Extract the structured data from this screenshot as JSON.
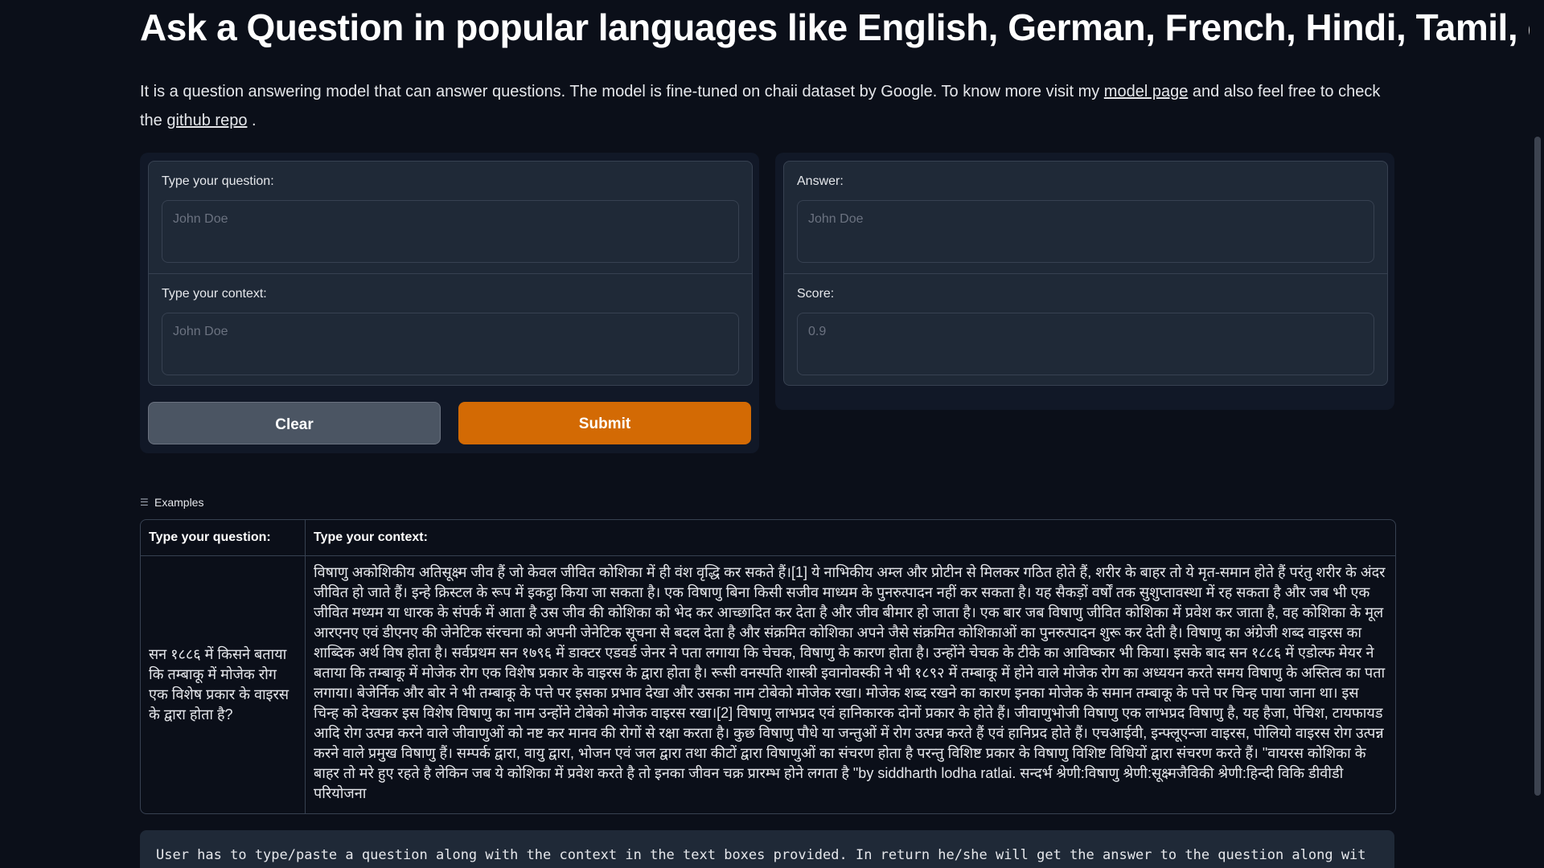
{
  "page": {
    "title": "Ask a Question in popular languages like English, German, French, Hindi, Tamil, etc",
    "description_pre": "It is a question answering model that can answer questions. The model is fine-tuned on chaii dataset by Google. To know more visit my ",
    "model_link": "model page",
    "description_mid": " and also feel free to check the ",
    "github_link": "github repo",
    "description_post": " ."
  },
  "inputs": {
    "question_label": "Type your question:",
    "question_placeholder": "John Doe",
    "context_label": "Type your context:",
    "context_placeholder": "John Doe"
  },
  "outputs": {
    "answer_label": "Answer:",
    "answer_placeholder": "John Doe",
    "score_label": "Score:",
    "score_placeholder": "0.9"
  },
  "buttons": {
    "clear": "Clear",
    "submit": "Submit"
  },
  "examples": {
    "header": "Examples",
    "col_question": "Type your question:",
    "col_context": "Type your context:",
    "rows": [
      {
        "question": "सन १८८६ में किसने बताया कि तम्बाकू में मोजेक रोग एक विशेष प्रकार के वाइरस के द्वारा होता है?",
        "context": "विषाणु अकोशिकीय अतिसूक्ष्म जीव हैं जो केवल जीवित कोशिका में ही वंश वृद्धि कर सकते हैं।[1] ये नाभिकीय अम्ल और प्रोटीन से मिलकर गठित होते हैं, शरीर के बाहर तो ये मृत-समान होते हैं परंतु शरीर के अंदर जीवित हो जाते हैं। इन्हे क्रिस्टल के रूप में इकट्ठा किया जा सकता है। एक विषाणु बिना किसी सजीव माध्यम के पुनरुत्पादन नहीं कर सकता है। यह सैकड़ों वर्षों तक सुशुप्तावस्था में रह सकता है और जब भी एक जीवित मध्यम या धारक के संपर्क में आता है उस जीव की कोशिका को भेद कर आच्छादित कर देता है और जीव बीमार हो जाता है। एक बार जब विषाणु जीवित कोशिका में प्रवेश कर जाता है, वह कोशिका के मूल आरएनए एवं डीएनए की जेनेटिक संरचना को अपनी जेनेटिक सूचना से बदल देता है और संक्रमित कोशिका अपने जैसे संक्रमित कोशिकाओं का पुनरुत्पादन शुरू कर देती है। विषाणु का अंग्रेजी शब्द वाइरस का शाब्दिक अर्थ विष होता है। सर्वप्रथम सन १७९६ में डाक्टर एडवर्ड जेनर ने पता लगाया कि चेचक, विषाणु के कारण होता है। उन्होंने चेचक के टीके का आविष्कार भी किया। इसके बाद सन १८८६ में एडोल्फ मेयर ने बताया कि तम्बाकू में मोजेक रोग एक विशेष प्रकार के वाइरस के द्वारा होता है। रूसी वनस्पति शास्त्री इवानोवस्की ने भी १८९२ में तम्बाकू में होने वाले मोजेक रोग का अध्ययन करते समय विषाणु के अस्तित्व का पता लगाया। बेजेर्निक और बोर ने भी तम्बाकू के पत्ते पर इसका प्रभाव देखा और उसका नाम टोबेको मोजेक रखा। मोजेक शब्द रखने का कारण इनका मोजेक के समान तम्बाकू के पत्ते पर चिन्ह पाया जाना था। इस चिन्ह को देखकर इस विशेष विषाणु का नाम उन्होंने टोबेको मोजेक वाइरस रखा।[2] विषाणु लाभप्रद एवं हानिकारक दोनों प्रकार के होते हैं। जीवाणुभोजी विषाणु एक लाभप्रद विषाणु है, यह हैजा, पेचिश, टायफायड आदि रोग उत्पन्न करने वाले जीवाणुओं को नष्ट कर मानव की रोगों से रक्षा करता है। कुछ विषाणु पौधे या जन्तुओं में रोग उत्पन्न करते हैं एवं हानिप्रद होते हैं। एचआईवी, इन्फ्लूएन्जा वाइरस, पोलियो वाइरस रोग उत्पन्न करने वाले प्रमुख विषाणु हैं। सम्पर्क द्वारा, वायु द्वारा, भोजन एवं जल द्वारा तथा कीटों द्वारा विषाणुओं का संचरण होता है परन्तु विशिष्ट प्रकार के विषाणु विशिष्ट विधियों द्वारा संचरण करते हैं। \"वायरस कोशिका के बाहर तो मरे हुए रहते है लेकिन जब ये कोशिका में प्रवेश करते है तो इनका जीवन चक्र प्रारम्भ होने लगता है \"by siddharth lodha ratlai. सन्दर्भ श्रेणी:विषाणु श्रेणी:सूक्ष्मजैविकी श्रेणी:हिन्दी विकि डीवीडी परियोजना"
      }
    ]
  },
  "notes": {
    "text": "User has to type/paste a question along with the context in the text boxes provided. In return he/she will get the answer to the question along wit"
  }
}
